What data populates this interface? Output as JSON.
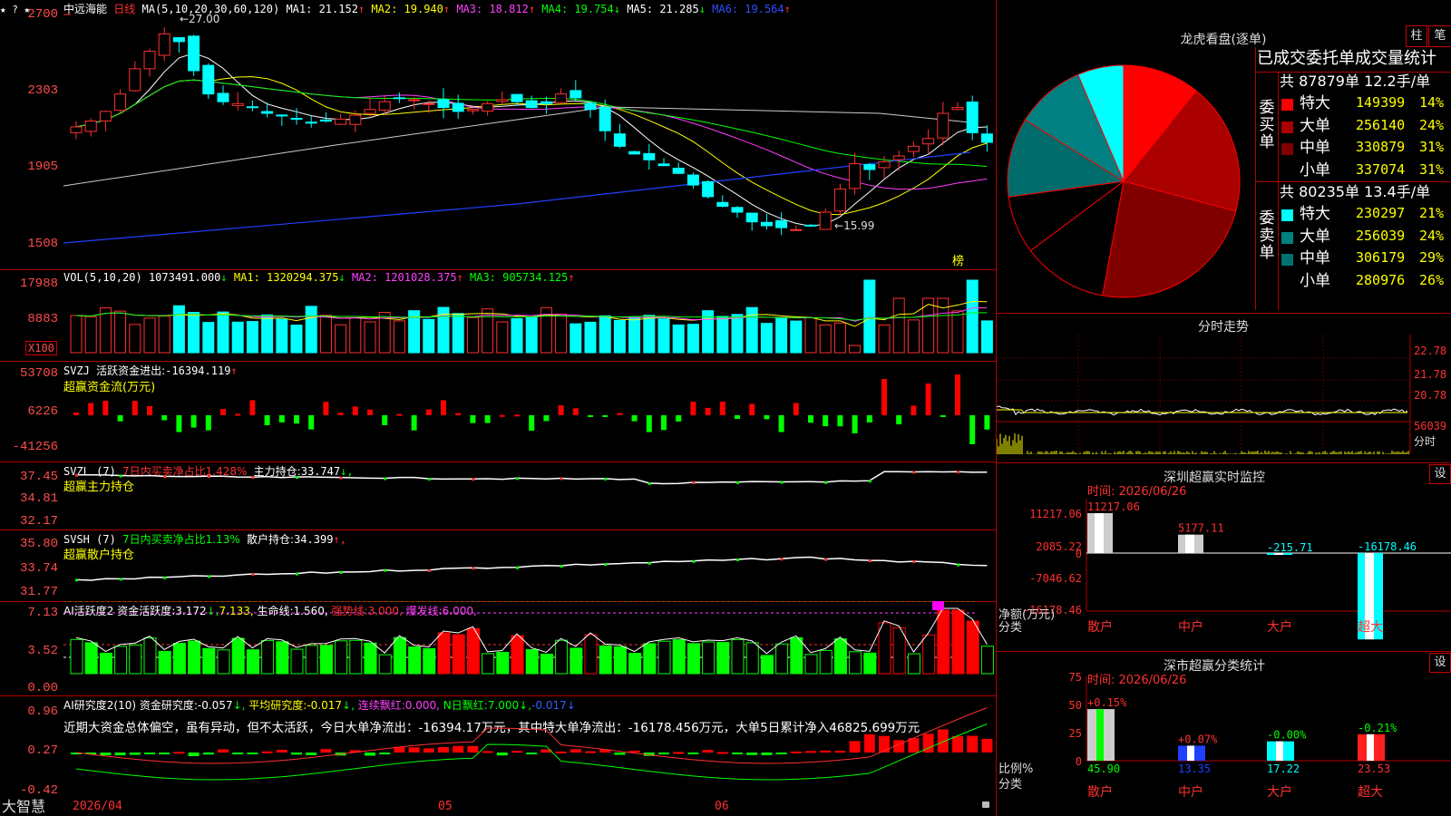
{
  "stock": {
    "name": "中远海能",
    "period": "日线",
    "ma_params": "MA(5,10,20,30,60,120)",
    "ma_values": [
      {
        "label": "MA1:",
        "value": "21.152",
        "arrow": "↑",
        "color": "#ffffff"
      },
      {
        "label": "MA2:",
        "value": "19.940",
        "arrow": "↑",
        "color": "#ffff00"
      },
      {
        "label": "MA3:",
        "value": "18.812",
        "arrow": "↑",
        "color": "#ff40ff"
      },
      {
        "label": "MA4:",
        "value": "19.754",
        "arrow": "↓",
        "color": "#00ff00"
      },
      {
        "label": "MA5:",
        "value": "21.285",
        "arrow": "↓",
        "color": "#ffffff"
      },
      {
        "label": "MA6:",
        "value": "19.564",
        "arrow": "↑",
        "color": "#3050ff"
      }
    ],
    "price_high_label": "27.00",
    "price_low_label": "15.99",
    "price_axis": [
      "2700",
      "2303",
      "1905",
      "1508"
    ],
    "bang_label": "榜"
  },
  "volume": {
    "header": "VOL(5,10,20)",
    "value": "1073491.000",
    "value_arrow": "↓",
    "ma": [
      {
        "label": "MA1:",
        "value": "1320294.375",
        "arrow": "↓",
        "color": "#ffff00"
      },
      {
        "label": "MA2:",
        "value": "1201028.375",
        "arrow": "↑",
        "color": "#ff40ff"
      },
      {
        "label": "MA3:",
        "value": "905734.125",
        "arrow": "↑",
        "color": "#00ff00"
      }
    ],
    "axis": [
      "17988",
      "8883"
    ],
    "unit": "X100"
  },
  "svzj": {
    "header": "SVZJ",
    "label": "活跃资金进出:",
    "value": "-16394.119",
    "arrow": "↑",
    "sub": "超赢资金流(万元)",
    "axis": [
      "53708",
      "6226",
      "-41256"
    ]
  },
  "svzl": {
    "header": "SVZL (7)",
    "net": "7日内买卖净占比1.428%",
    "label": "主力持仓:",
    "value": "33.747",
    "arrow": "↓,",
    "sub": "超赢主力持仓",
    "axis": [
      "37.45",
      "34.81",
      "32.17"
    ]
  },
  "svsh": {
    "header": "SVSH (7)",
    "net": "7日内买卖净占比1.13%",
    "label": "散户持仓:",
    "value": "34.399",
    "arrow": "↑,",
    "sub": "超赢散户持仓",
    "axis": [
      "35.80",
      "33.74",
      "31.77"
    ]
  },
  "ai_active": {
    "header": "AI活跃度2",
    "l1": "资金活跃度:",
    "v1": "3.172",
    "a1": "↓,",
    "v2": "7.133,",
    "l3": "生命线:",
    "v3": "1.560,",
    "l4": "强势线:",
    "v4": "3.000,",
    "l5": "爆发线:",
    "v5": "6.000,",
    "axis": [
      "7.13",
      "3.52",
      "0.00"
    ]
  },
  "ai_research": {
    "header": "AI研究度2(10)",
    "l1": "资金研究度:",
    "v1": "-0.057",
    "a1": "↓,",
    "l2": "平均研究度:",
    "v2": "-0.017",
    "a2": "↓,",
    "l3": "连续飘红:",
    "v3": "0.000,",
    "l4": "N日飘红:",
    "v4": "7.000",
    "a4": "↓,",
    "v5": "-0.017",
    "a5": "↓",
    "comment": "近期大资金总体偏空，虽有异动，但不太活跃，今日大单净流出：-16394.17万元，其中特大单净流出：-16178.456万元，大单5日累计净入46825.699万元",
    "axis": [
      "0.96",
      "0.27",
      "-0.42"
    ]
  },
  "date_axis": {
    "first": "2026/04",
    "m2": "05",
    "m3": "06"
  },
  "brand": "大智慧",
  "dragon": {
    "title": "龙虎看盘(逐单)",
    "btn1": "柱",
    "btn2": "笔",
    "subtitle": "已成交委托单成交量统计",
    "buy_label": "委买单",
    "buy_total": "共 87879单 12.2手/单",
    "sell_label": "委卖单",
    "sell_total": "共 80235单 13.4手/单",
    "buy_rows": [
      {
        "name": "特大",
        "value": "149399",
        "pct": "14%",
        "color": "#ff0000"
      },
      {
        "name": "大单",
        "value": "256140",
        "pct": "24%",
        "color": "#aa0000"
      },
      {
        "name": "中单",
        "value": "330879",
        "pct": "31%",
        "color": "#800000"
      },
      {
        "name": "小单",
        "value": "337074",
        "pct": "31%",
        "color": "#000000"
      }
    ],
    "sell_rows": [
      {
        "name": "特大",
        "value": "230297",
        "pct": "21%",
        "color": "#00ffff"
      },
      {
        "name": "大单",
        "value": "256039",
        "pct": "24%",
        "color": "#008080"
      },
      {
        "name": "中单",
        "value": "306179",
        "pct": "29%",
        "color": "#007070"
      },
      {
        "name": "小单",
        "value": "280976",
        "pct": "26%",
        "color": "#000000"
      }
    ]
  },
  "intraday": {
    "title": "分时走势",
    "axis": [
      "22.78",
      "21.78",
      "20.78",
      "56039",
      "分时"
    ]
  },
  "sz_monitor": {
    "title": "深圳超赢实时监控",
    "btn": "设",
    "time": "时间: 2026/06/26",
    "axis": [
      "11217.06",
      "2085.22",
      "0",
      "-7046.62",
      "-16178.46"
    ],
    "ylabel1": "净额(万元)",
    "ylabel2": "分类",
    "bars": [
      {
        "name": "散户",
        "value": "11217.06"
      },
      {
        "name": "中户",
        "value": "5177.11"
      },
      {
        "name": "大户",
        "value": "-215.71"
      },
      {
        "name": "超大",
        "value": "-16178.46"
      }
    ]
  },
  "sz_category": {
    "title": "深市超赢分类统计",
    "btn": "设",
    "time": "时间: 2026/06/26",
    "axis": [
      "75",
      "50",
      "25",
      "0"
    ],
    "ylabel1": "比例%",
    "ylabel2": "分类",
    "bars": [
      {
        "name": "散户",
        "value": "45.90",
        "delta": "+0.15%"
      },
      {
        "name": "中户",
        "value": "13.35",
        "delta": "+0.07%"
      },
      {
        "name": "大户",
        "value": "17.22",
        "delta": "-0.00%"
      },
      {
        "name": "超大",
        "value": "23.53",
        "delta": "-0.21%"
      }
    ]
  }
}
